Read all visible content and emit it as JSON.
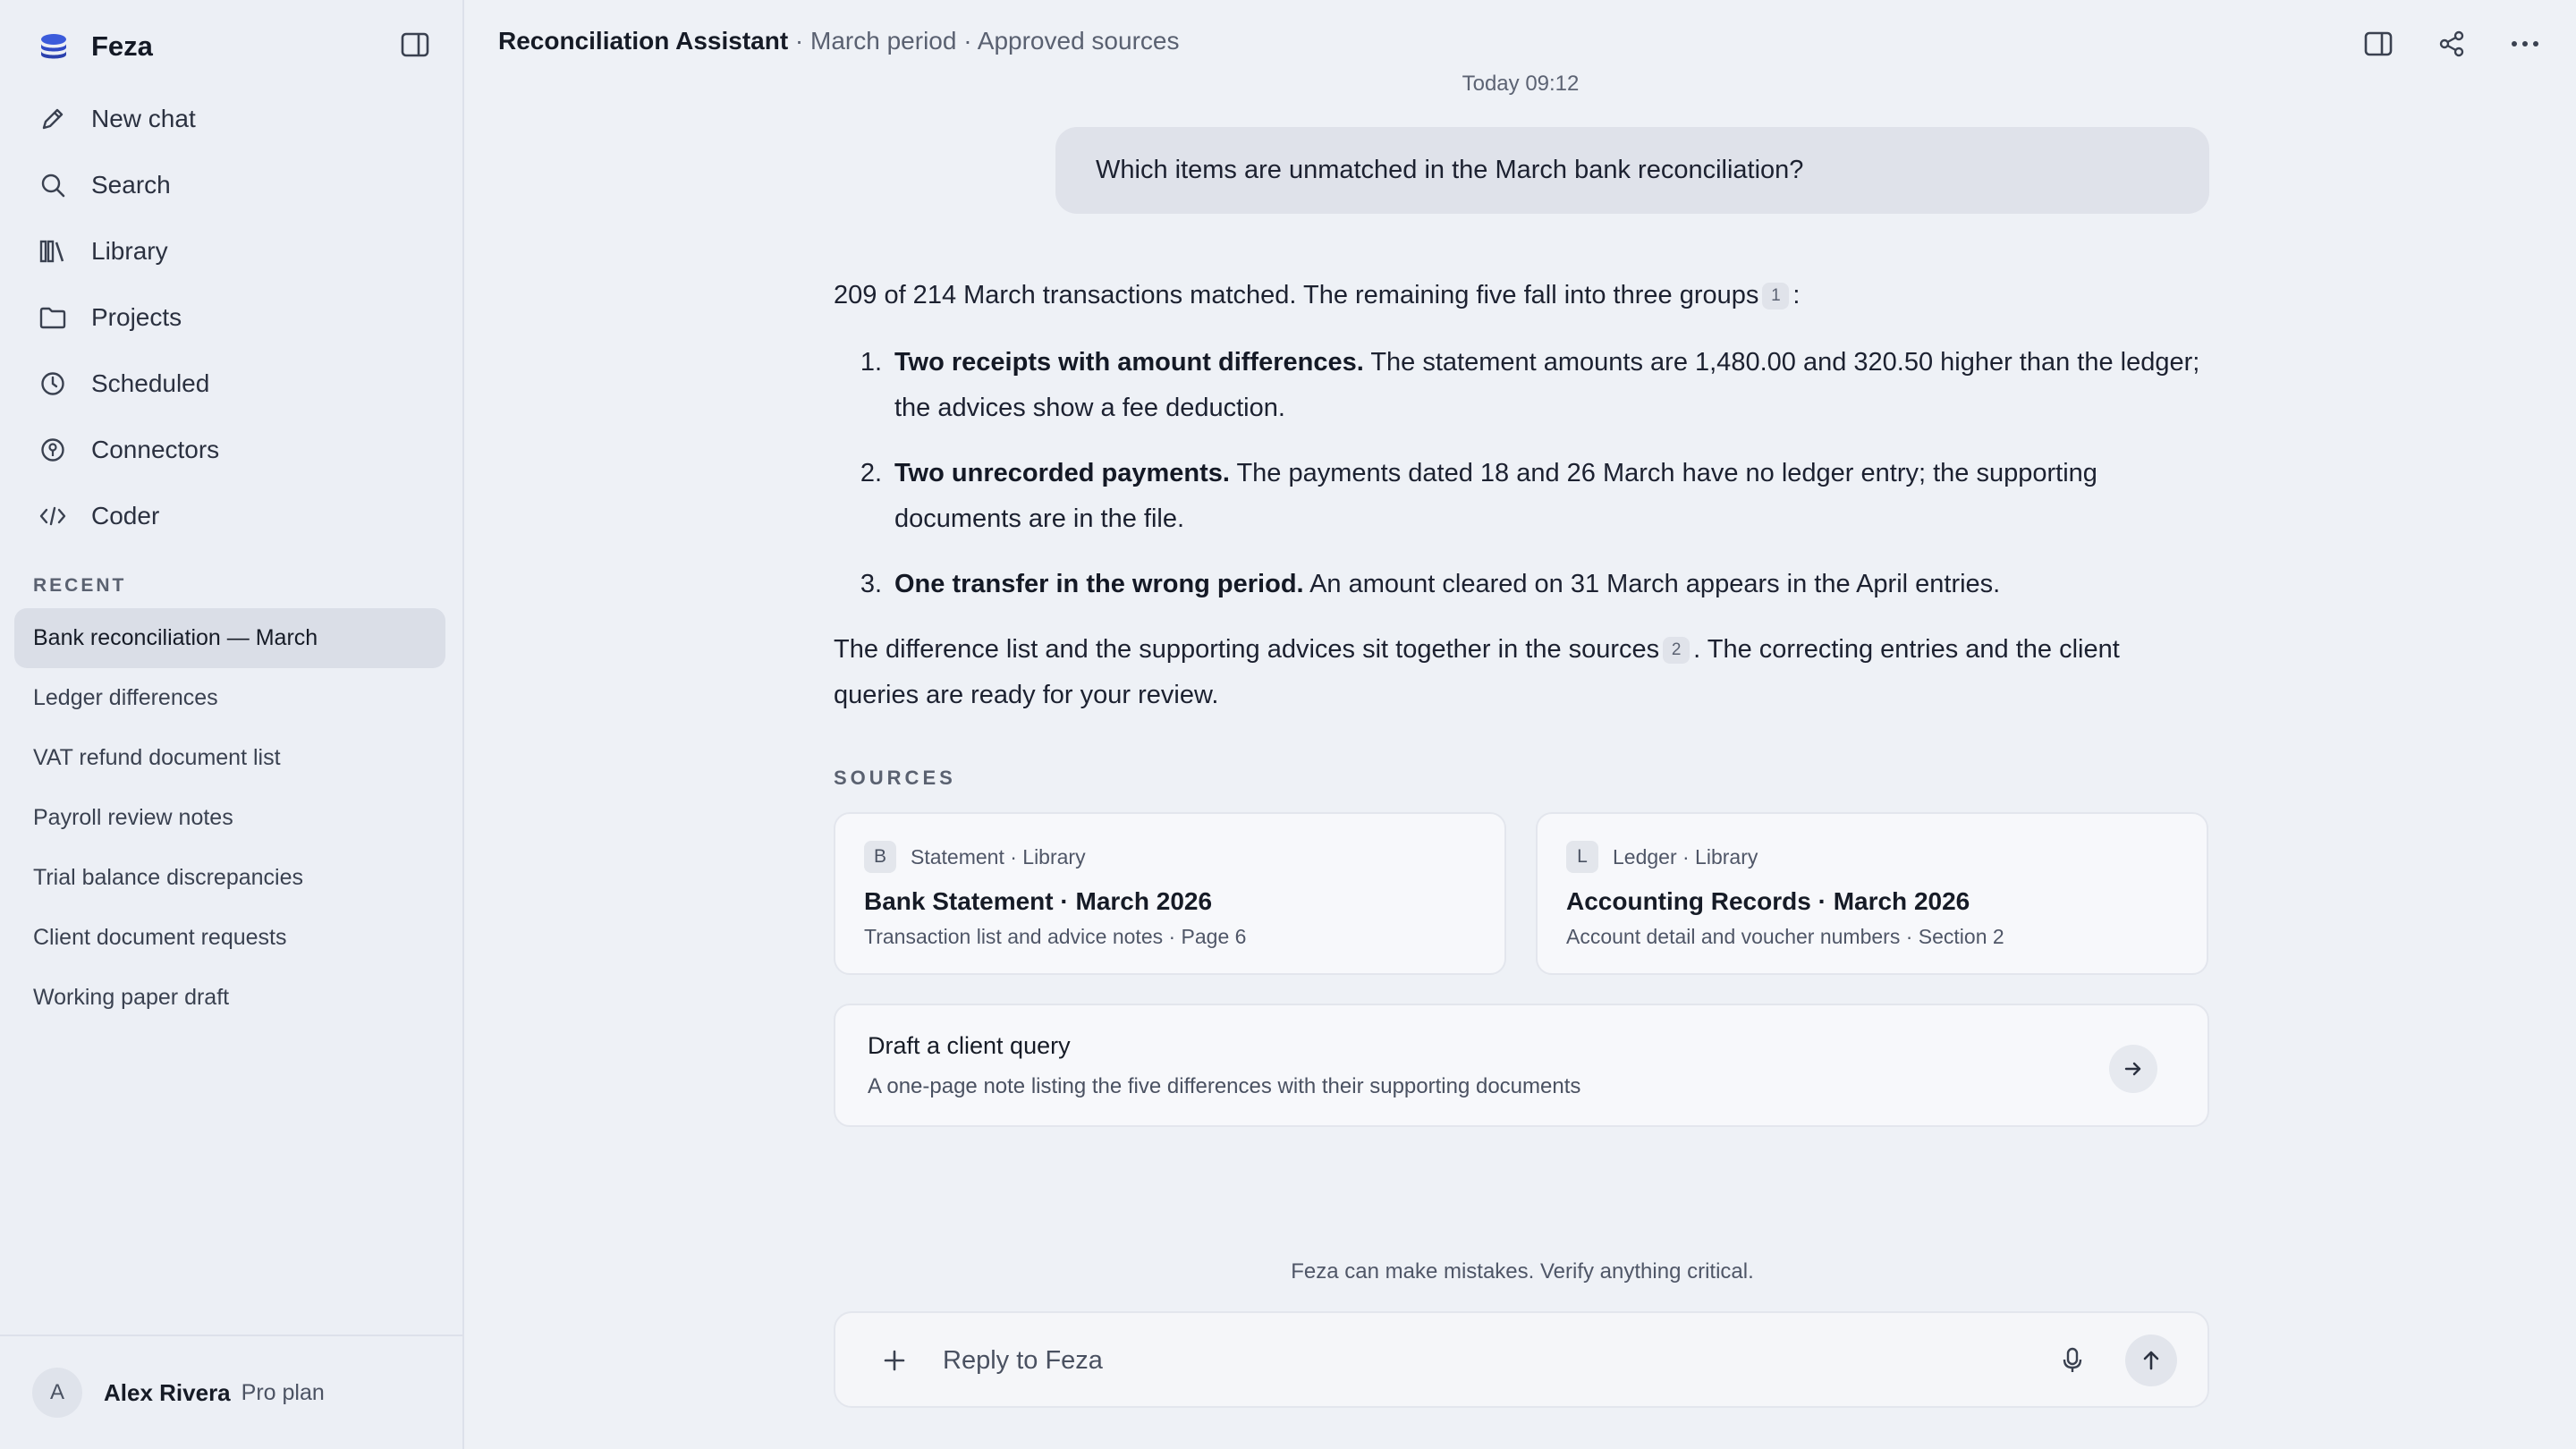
{
  "sidebar": {
    "brand": "Feza",
    "nav": [
      {
        "label": "New chat",
        "icon": "pencil-icon"
      },
      {
        "label": "Search",
        "icon": "search-icon"
      },
      {
        "label": "Library",
        "icon": "library-icon"
      },
      {
        "label": "Projects",
        "icon": "folder-icon"
      },
      {
        "label": "Scheduled",
        "icon": "clock-icon"
      },
      {
        "label": "Connectors",
        "icon": "connector-icon"
      },
      {
        "label": "Coder",
        "icon": "code-icon"
      }
    ],
    "recent_label": "RECENT",
    "recent": [
      {
        "label": "Bank reconciliation — March",
        "active": true
      },
      {
        "label": "Ledger differences"
      },
      {
        "label": "VAT refund document list"
      },
      {
        "label": "Payroll review notes"
      },
      {
        "label": "Trial balance discrepancies"
      },
      {
        "label": "Client document requests"
      },
      {
        "label": "Working paper draft"
      }
    ],
    "user": {
      "initial": "A",
      "name": "Alex Rivera",
      "plan": "Pro plan"
    }
  },
  "header": {
    "title": "Reconciliation Assistant",
    "subtitle": " · March period · Approved sources"
  },
  "chat": {
    "timestamp": "Today 09:12",
    "user_message": "Which items are unmatched in the March bank reconciliation?",
    "answer": {
      "intro": "209 of 214 March transactions matched. The remaining five fall into three groups",
      "intro_cite": "1",
      "intro_end": ":",
      "items": [
        {
          "num": "1.",
          "bold": "Two receipts with amount differences.",
          "text": " The statement amounts are 1,480.00 and 320.50 higher than the ledger; the advices show a fee deduction."
        },
        {
          "num": "2.",
          "bold": "Two unrecorded payments.",
          "text": " The payments dated 18 and 26 March have no ledger entry; the supporting documents are in the file."
        },
        {
          "num": "3.",
          "bold": "One transfer in the wrong period.",
          "text": " An amount cleared on 31 March appears in the April entries."
        }
      ],
      "outro_a": "The difference list and the supporting advices sit together in the sources",
      "outro_cite": "2",
      "outro_b": ". The correcting entries and the client queries are ready for your review."
    },
    "sources_label": "SOURCES",
    "sources": [
      {
        "badge": "B",
        "meta": "Statement · Library",
        "title": "Bank Statement · March 2026",
        "desc": "Transaction list and advice notes · Page 6"
      },
      {
        "badge": "L",
        "meta": "Ledger · Library",
        "title": "Accounting Records · March 2026",
        "desc": "Account detail and voucher numbers · Section 2"
      }
    ],
    "draft": {
      "title": "Draft a client query",
      "desc": "A one-page note listing the five differences with their supporting documents"
    },
    "disclaimer": "Feza can make mistakes. Verify anything critical.",
    "composer": {
      "placeholder": "Reply to Feza",
      "value": ""
    }
  }
}
